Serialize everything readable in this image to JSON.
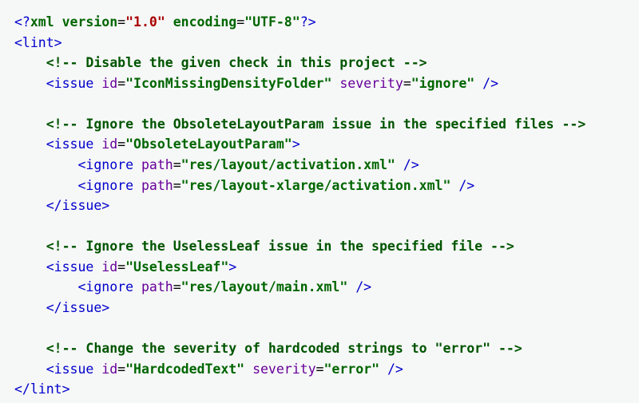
{
  "xml": {
    "decl_open": "<?",
    "decl_xml": "xml",
    "version_attr": "version",
    "version_val": "\"1.0\"",
    "encoding_attr": "encoding",
    "encoding_val": "\"UTF-8\"",
    "decl_close": "?>",
    "root_open": "<lint>",
    "root_close": "</lint>",
    "comment1": "<!-- Disable the given check in this project -->",
    "issue1_open": "<issue",
    "id_attr": "id",
    "issue1_id": "\"IconMissingDensityFolder\"",
    "severity_attr": "severity",
    "issue1_sev": "\"ignore\"",
    "self_close": " />",
    "comment2": "<!-- Ignore the ObsoleteLayoutParam issue in the specified files -->",
    "issue2_open": "<issue",
    "issue2_id": "\"ObsoleteLayoutParam\"",
    "tag_close": ">",
    "ignore_open": "<ignore",
    "path_attr": "path",
    "ignore2a_val": "\"res/layout/activation.xml\"",
    "ignore2b_val": "\"res/layout-xlarge/activation.xml\"",
    "issue_close": "</issue>",
    "comment3": "<!-- Ignore the UselessLeaf issue in the specified file -->",
    "issue3_id": "\"UselessLeaf\"",
    "ignore3_val": "\"res/layout/main.xml\"",
    "comment4": "<!-- Change the severity of hardcoded strings to \"error\" -->",
    "issue4_id": "\"HardcodedText\"",
    "issue4_sev": "\"error\"",
    "eq": "="
  }
}
